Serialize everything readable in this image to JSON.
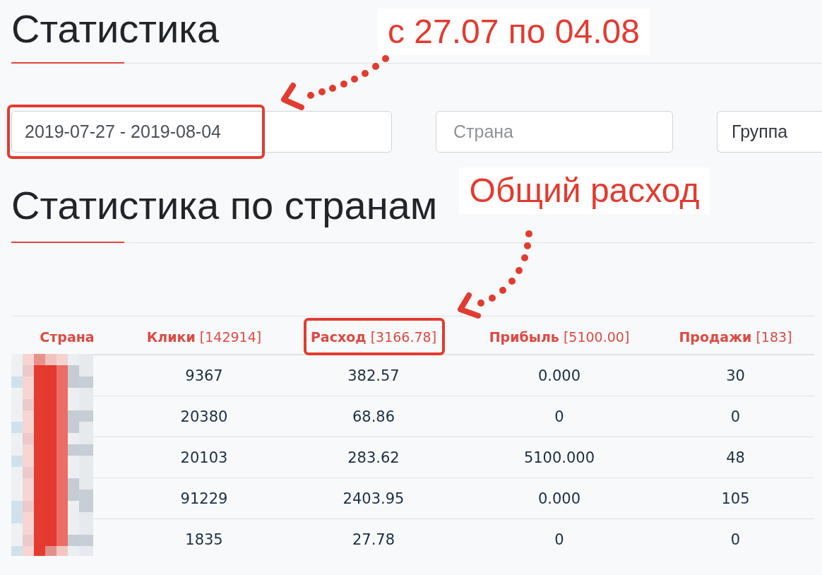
{
  "page": {
    "title": "Статистика"
  },
  "filters": {
    "date_range": {
      "value": "2019-07-27 - 2019-08-04",
      "highlighted": true
    },
    "country": {
      "placeholder": "Страна"
    },
    "group": {
      "value": "Группа"
    }
  },
  "section": {
    "title": "Статистика по странам"
  },
  "table": {
    "columns": [
      {
        "label": "Страна",
        "highlighted": false
      },
      {
        "label": "Клики",
        "total": "[142914]",
        "highlighted": false
      },
      {
        "label": "Расход",
        "total": "[3166.78]",
        "highlighted": true
      },
      {
        "label": "Прибыль",
        "total": "[5100.00]",
        "highlighted": false
      },
      {
        "label": "Продажи",
        "total": "[183]",
        "highlighted": false
      }
    ],
    "rows": [
      {
        "cells": [
          "",
          "9367",
          "382.57",
          "0.000",
          "30"
        ]
      },
      {
        "cells": [
          "",
          "20380",
          "68.86",
          "0",
          "0"
        ]
      },
      {
        "cells": [
          "",
          "20103",
          "283.62",
          "5100.000",
          "48"
        ]
      },
      {
        "cells": [
          "",
          "91229",
          "2403.95",
          "0.000",
          "105"
        ]
      },
      {
        "cells": [
          "",
          "1835",
          "27.78",
          "0",
          "0"
        ]
      }
    ]
  },
  "annotations": [
    {
      "text": "с 27.07 по 04.08"
    },
    {
      "text": "Общий расход"
    }
  ]
}
